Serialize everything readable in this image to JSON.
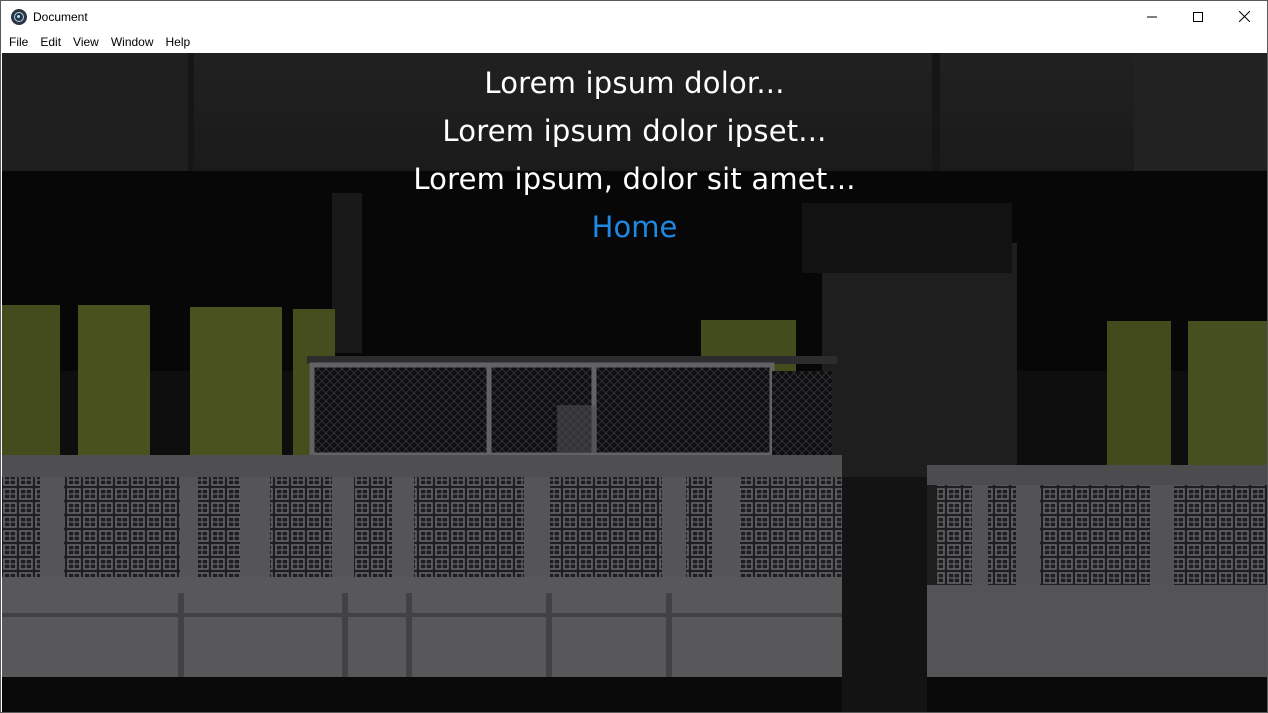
{
  "window": {
    "title": "Document",
    "icon": "electron-app-icon"
  },
  "menu": {
    "items": [
      {
        "label": "File"
      },
      {
        "label": "Edit"
      },
      {
        "label": "View"
      },
      {
        "label": "Window"
      },
      {
        "label": "Help"
      }
    ]
  },
  "content": {
    "lines": [
      "Lorem ipsum dolor...",
      "Lorem ipsum dolor ipset...",
      "Lorem ipsum, dolor sit amet..."
    ],
    "link_label": "Home",
    "background": "dim-building-photo",
    "link_color": "#1e88e5",
    "text_color": "#ffffff"
  }
}
